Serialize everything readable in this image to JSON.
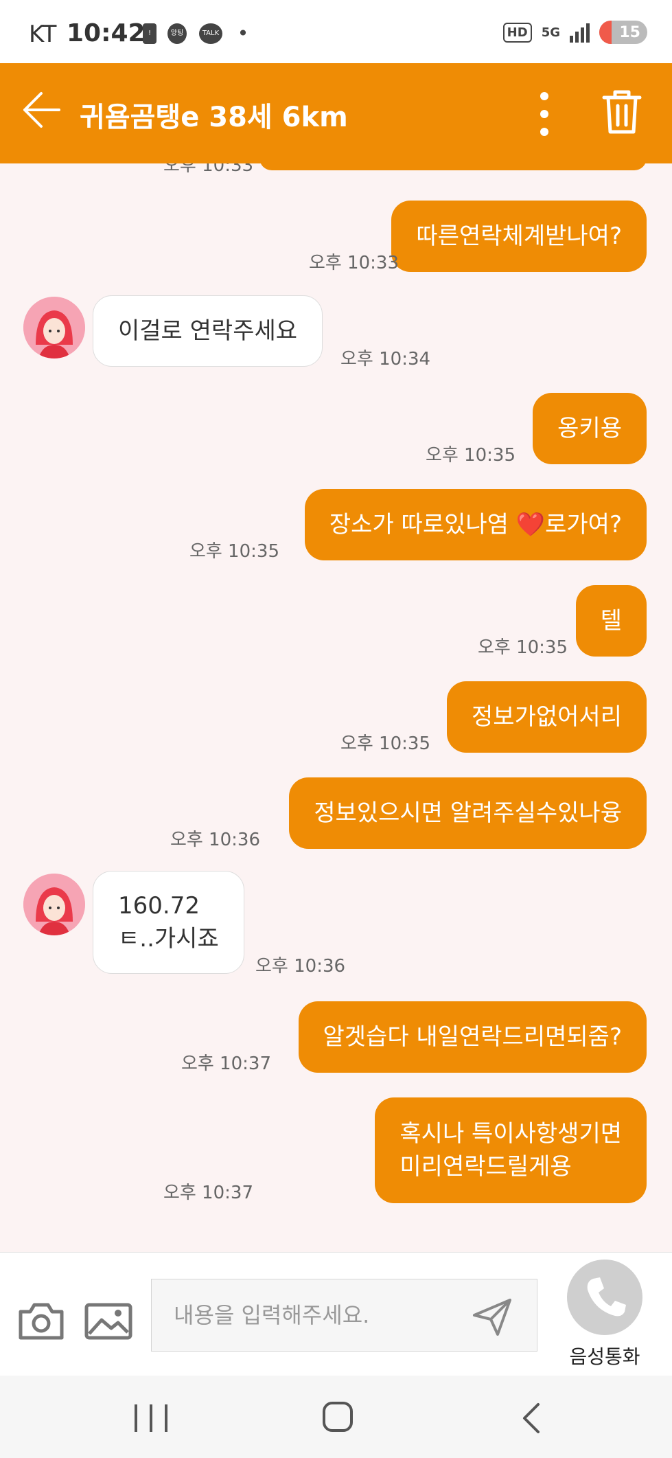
{
  "status_bar": {
    "carrier": "KT",
    "time": "10:42",
    "badges": [
      "!",
      "앙팅",
      "TALK",
      "•"
    ],
    "hd": "HD",
    "network": "5G",
    "battery": "15"
  },
  "header": {
    "title": "귀욤곰탱e 38세 6km",
    "icons": {
      "back": "back-arrow-icon",
      "more": "more-vertical-icon",
      "delete": "trash-icon"
    }
  },
  "colors": {
    "accent": "#ef8c05",
    "chat_bg": "#fcf3f3",
    "incoming_bubble": "#ffffff",
    "avatar_bg": "#f6a4b4"
  },
  "messages": [
    {
      "sender": "me",
      "text": "따른연락체계받나여?",
      "time": "오후 10:33"
    },
    {
      "sender": "them",
      "text": "이걸로 연락주세요",
      "time": "오후 10:34"
    },
    {
      "sender": "me",
      "text": "옹키용",
      "time": "오후 10:35"
    },
    {
      "sender": "me",
      "text_before": "장소가 따로있나염 ",
      "emoji": "❤️",
      "text_after": "로가여?",
      "time": "오후 10:35"
    },
    {
      "sender": "me",
      "text": "텔",
      "time": "오후 10:35"
    },
    {
      "sender": "me",
      "text": "정보가없어서리",
      "time": "오후 10:35"
    },
    {
      "sender": "me",
      "text": "정보있으시면 알려주실수있나융",
      "time": "오후 10:36"
    },
    {
      "sender": "them",
      "lines": [
        "160.72",
        "ㅌ..가시죠"
      ],
      "time": "오후 10:36"
    },
    {
      "sender": "me",
      "text": "알겟습다 내일연락드리면되줌?",
      "time": "오후 10:37"
    },
    {
      "sender": "me",
      "lines": [
        "혹시나 특이사항생기면",
        "미리연락드릴게용"
      ],
      "time": "오후 10:37"
    }
  ],
  "partial_top": {
    "time": "오후 10:33"
  },
  "input_bar": {
    "placeholder": "내용을 입력해주세요.",
    "call_label": "음성통화",
    "icons": {
      "camera": "camera-icon",
      "gallery": "image-icon",
      "send": "send-icon",
      "call": "phone-icon"
    }
  },
  "nav_bar": {
    "icons": [
      "recent-apps-icon",
      "home-icon",
      "back-icon"
    ]
  }
}
